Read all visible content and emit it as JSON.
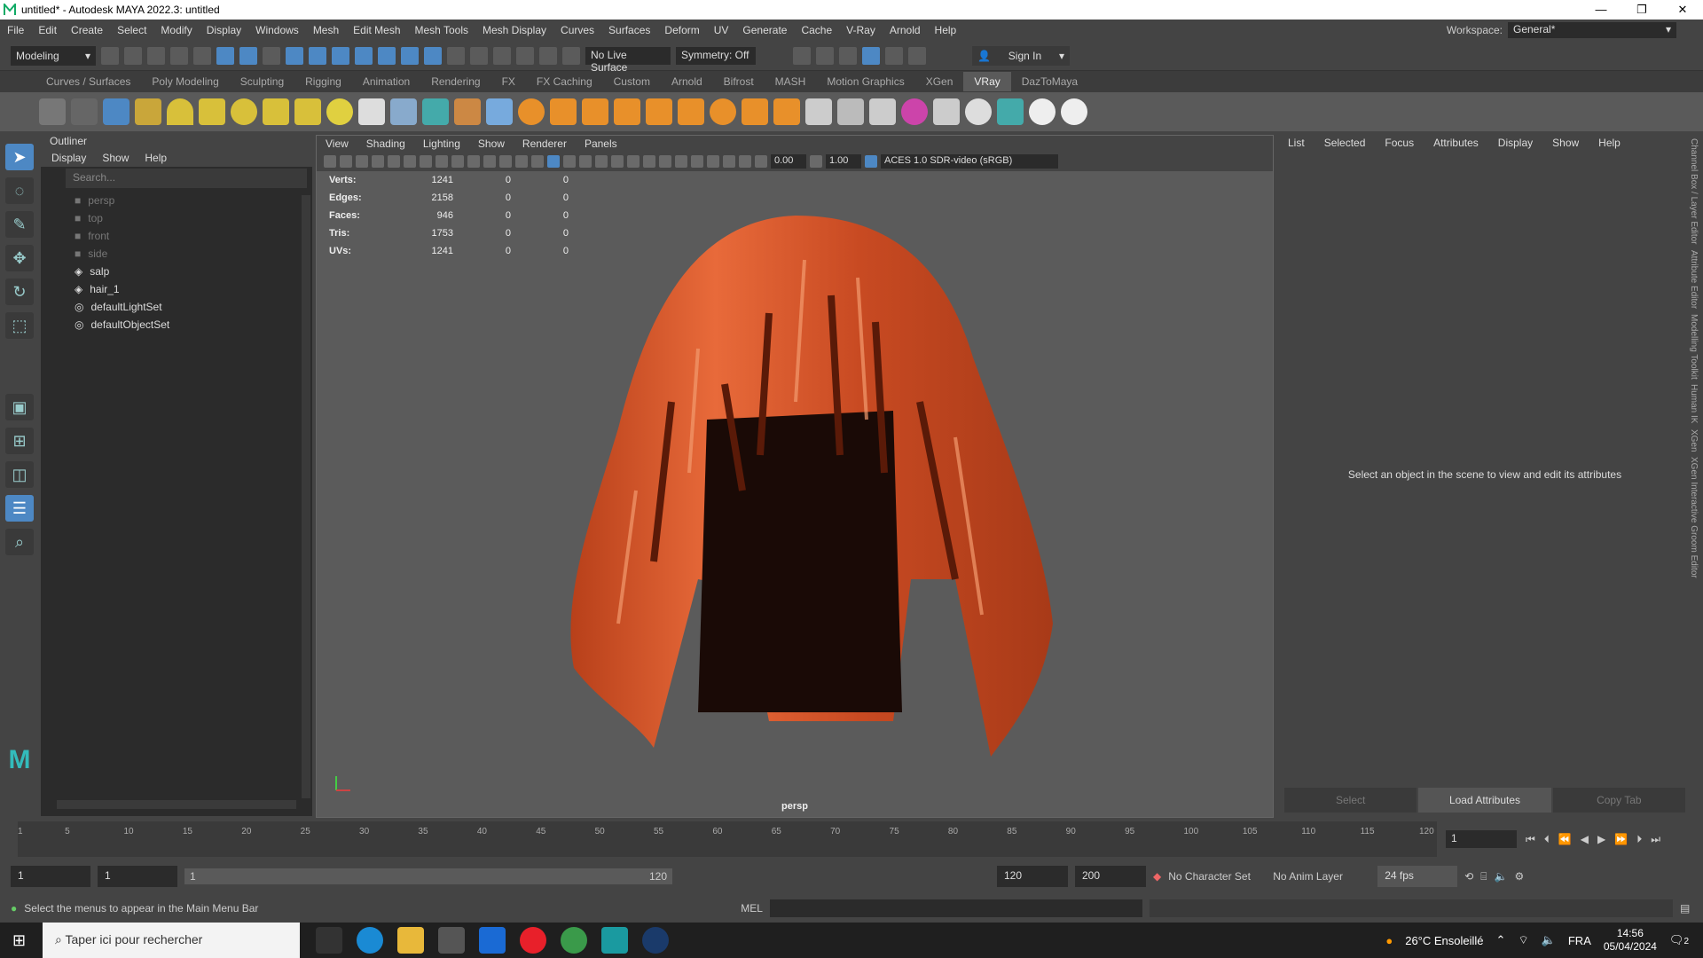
{
  "titlebar": {
    "title": "untitled* - Autodesk MAYA 2022.3: untitled"
  },
  "menus": [
    "File",
    "Edit",
    "Create",
    "Select",
    "Modify",
    "Display",
    "Windows",
    "Mesh",
    "Edit Mesh",
    "Mesh Tools",
    "Mesh Display",
    "Curves",
    "Surfaces",
    "Deform",
    "UV",
    "Generate",
    "Cache",
    "V-Ray",
    "Arnold",
    "Help"
  ],
  "workspace": {
    "label": "Workspace:",
    "value": "General*"
  },
  "status": {
    "mode": "Modeling",
    "live": "No Live Surface",
    "symmetry": "Symmetry: Off",
    "signin": "Sign In"
  },
  "shelf_tabs": [
    "Curves / Surfaces",
    "Poly Modeling",
    "Sculpting",
    "Rigging",
    "Animation",
    "Rendering",
    "FX",
    "FX Caching",
    "Custom",
    "Arnold",
    "Bifrost",
    "MASH",
    "Motion Graphics",
    "XGen",
    "VRay",
    "DazToMaya"
  ],
  "shelf_active": "VRay",
  "outliner": {
    "title": "Outliner",
    "menus": [
      "Display",
      "Show",
      "Help"
    ],
    "search_placeholder": "Search...",
    "items": [
      {
        "label": "persp",
        "type": "camera",
        "dim": true
      },
      {
        "label": "top",
        "type": "camera",
        "dim": true
      },
      {
        "label": "front",
        "type": "camera",
        "dim": true
      },
      {
        "label": "side",
        "type": "camera",
        "dim": true
      },
      {
        "label": "salp",
        "type": "mesh",
        "dim": false
      },
      {
        "label": "hair_1",
        "type": "mesh",
        "dim": false
      },
      {
        "label": "defaultLightSet",
        "type": "set",
        "dim": false
      },
      {
        "label": "defaultObjectSet",
        "type": "set",
        "dim": false
      }
    ]
  },
  "viewport": {
    "menus": [
      "View",
      "Shading",
      "Lighting",
      "Show",
      "Renderer",
      "Panels"
    ],
    "exposure": "0.00",
    "gamma": "1.00",
    "colorspace": "ACES 1.0 SDR-video (sRGB)",
    "camera": "persp",
    "hud": [
      {
        "label": "Verts:",
        "a": "1241",
        "b": "0",
        "c": "0"
      },
      {
        "label": "Edges:",
        "a": "2158",
        "b": "0",
        "c": "0"
      },
      {
        "label": "Faces:",
        "a": "946",
        "b": "0",
        "c": "0"
      },
      {
        "label": "Tris:",
        "a": "1753",
        "b": "0",
        "c": "0"
      },
      {
        "label": "UVs:",
        "a": "1241",
        "b": "0",
        "c": "0"
      }
    ]
  },
  "attr_editor": {
    "menus": [
      "List",
      "Selected",
      "Focus",
      "Attributes",
      "Display",
      "Show",
      "Help"
    ],
    "message": "Select an object in the scene to view and edit its attributes",
    "buttons": [
      "Select",
      "Load Attributes",
      "Copy Tab"
    ]
  },
  "side_tabs": [
    "Channel Box / Layer Editor",
    "Attribute Editor",
    "Modelling Toolkit",
    "Human IK",
    "XGen",
    "XGen Interactive Groom Editor"
  ],
  "timeline": {
    "ticks": [
      "1",
      "5",
      "10",
      "15",
      "20",
      "25",
      "30",
      "35",
      "40",
      "45",
      "50",
      "55",
      "60",
      "65",
      "70",
      "75",
      "80",
      "85",
      "90",
      "95",
      "100",
      "105",
      "110",
      "115",
      "120"
    ],
    "current": "1"
  },
  "range": {
    "start": "1",
    "start2": "1",
    "slider_start": "1",
    "slider_end": "120",
    "end": "120",
    "end2": "200",
    "charset": "No Character Set",
    "animlayer": "No Anim Layer",
    "fps": "24 fps"
  },
  "helpline": {
    "text": "Select the menus to appear in the Main Menu Bar",
    "lang": "MEL"
  },
  "taskbar": {
    "search": "Taper ici pour rechercher",
    "weather": "26°C Ensoleillé",
    "lang": "FRA",
    "time": "14:56",
    "date": "05/04/2024",
    "notif": "2"
  }
}
